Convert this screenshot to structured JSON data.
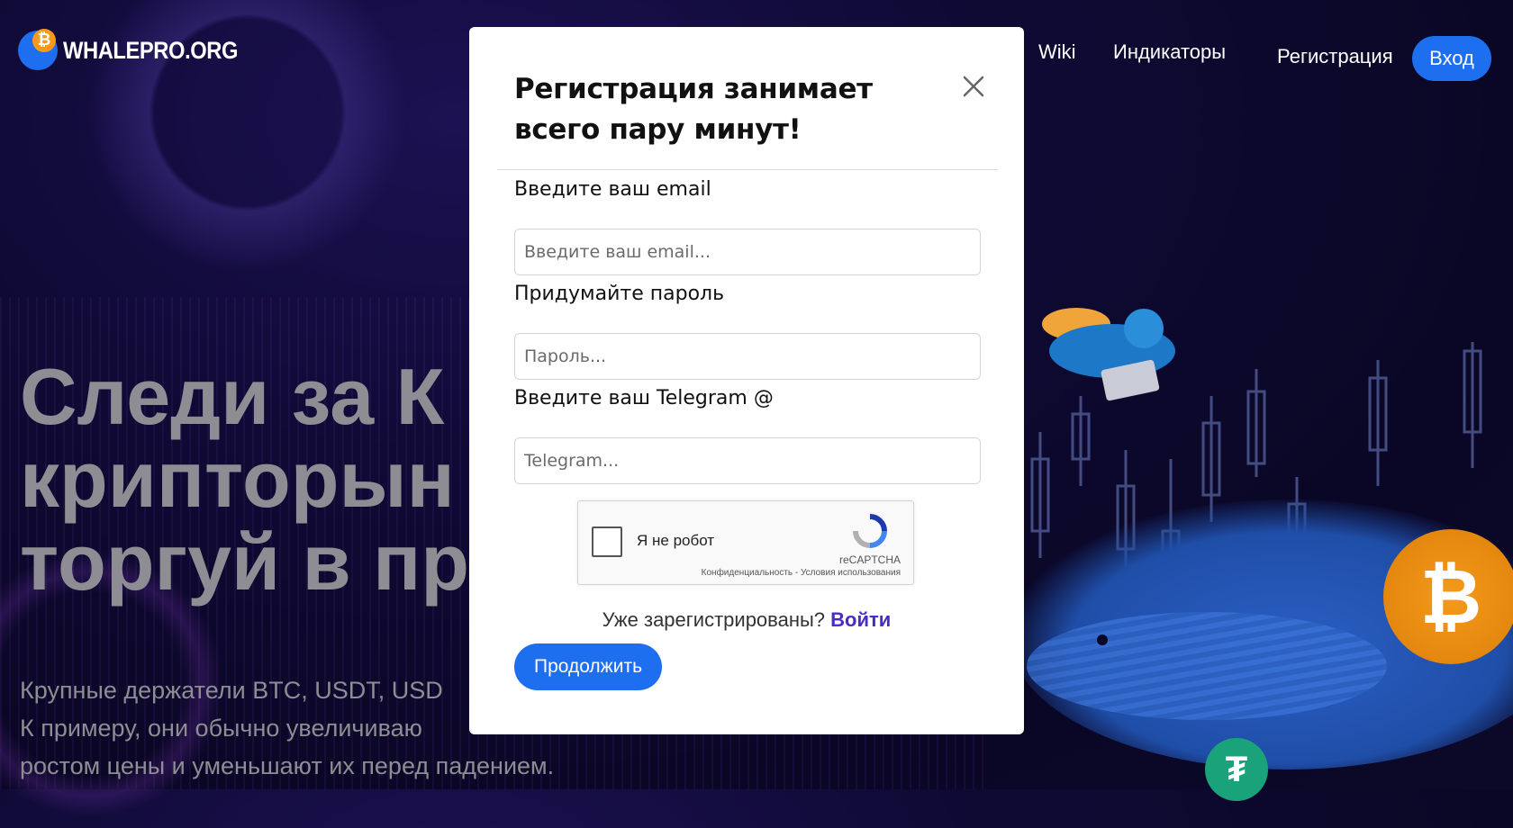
{
  "brand": {
    "name": "WHALEPRO.ORG",
    "coin_symbol": "₿"
  },
  "nav": {
    "items": [
      {
        "label": "Wiki"
      },
      {
        "label": "Индикаторы"
      },
      {
        "label": "Регистрация"
      }
    ],
    "login_label": "Вход"
  },
  "hero": {
    "title_lines": [
      "Следи за К",
      "крипторын",
      "торгуй в пр"
    ],
    "subtitle_lines": [
      "Крупные держатели BTC, USDT, USD",
      "К примеру, они обычно увеличиваю",
      "ростом цены и уменьшают их перед падением."
    ]
  },
  "modal": {
    "title": "Регистрация занимает всего пару минут!",
    "close_icon": "close-icon",
    "email": {
      "label": "Введите ваш email",
      "placeholder": "Введите ваш email..."
    },
    "password": {
      "label": "Придумайте пароль",
      "placeholder": "Пароль..."
    },
    "telegram": {
      "label": "Введите ваш Telegram @",
      "placeholder": "Telegram..."
    },
    "captcha": {
      "label": "Я не робот",
      "brand": "reCAPTCHA",
      "terms": "Конфиденциальность - Условия использования",
      "checked": false
    },
    "already_registered": "Уже зарегистрированы?",
    "login_link": "Войти",
    "continue_label": "Продолжить"
  },
  "colors": {
    "accent": "#1e6ff0",
    "link": "#4a2bc9",
    "background": "#0f0a35",
    "hero_text": "#8d8d93",
    "bitcoin": "#f59a1c",
    "tether": "#1aa37a"
  }
}
